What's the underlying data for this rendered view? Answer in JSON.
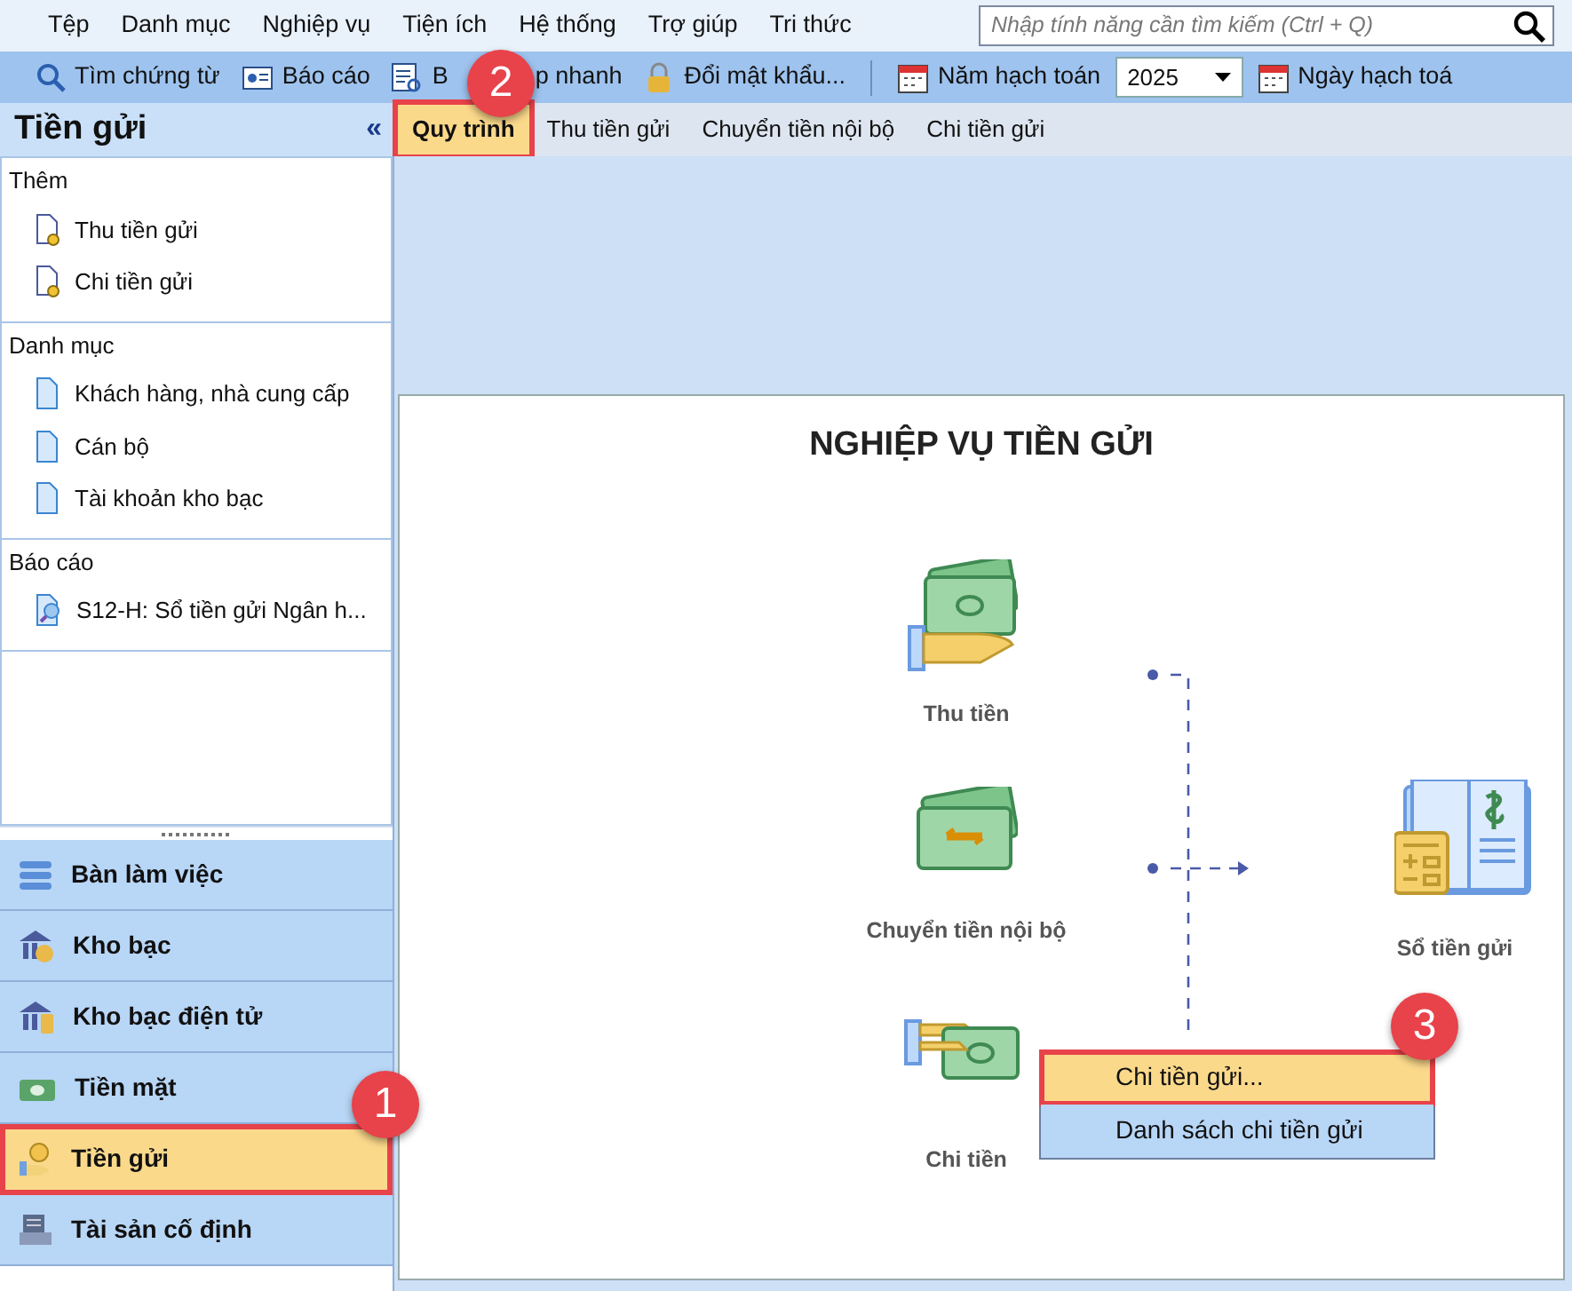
{
  "menu_bar": {
    "items": [
      "Tệp",
      "Danh mục",
      "Nghiệp vụ",
      "Tiện ích",
      "Hệ thống",
      "Trợ giúp",
      "Tri thức"
    ],
    "search": {
      "placeholder": "Nhập tính năng cần tìm kiếm (Ctrl + Q)"
    }
  },
  "toolbar": {
    "items": [
      {
        "kind": "button",
        "label": "Tìm chứng từ"
      },
      {
        "kind": "button",
        "label": "Báo cáo"
      },
      {
        "kind": "split",
        "label_parts": [
          "B",
          "p nhanh"
        ]
      },
      {
        "kind": "button",
        "label": "Đổi mật khẩu..."
      },
      {
        "kind": "separator"
      },
      {
        "kind": "button",
        "label": "Năm hạch toán"
      },
      {
        "kind": "select",
        "value": "2025"
      },
      {
        "kind": "button",
        "label": "Ngày hạch toá"
      }
    ]
  },
  "side_panel": {
    "title": "Tiền gửi",
    "collapse": "«",
    "sections": [
      {
        "title": "Thêm",
        "items": [
          {
            "label": "Thu tiền gửi"
          },
          {
            "label": "Chi tiền gửi"
          }
        ]
      },
      {
        "title": "Danh mục",
        "items": [
          {
            "label": "Khách hàng, nhà cung cấp"
          },
          {
            "label": "Cán bộ"
          },
          {
            "label": "Tài khoản kho bạc"
          }
        ]
      },
      {
        "title": "Báo cáo",
        "items": [
          {
            "label": "S12-H: Sổ tiền gửi Ngân h..."
          }
        ]
      }
    ],
    "modules": [
      {
        "label": "Bàn làm việc",
        "selected": false
      },
      {
        "label": "Kho bạc",
        "selected": false
      },
      {
        "label": "Kho bạc điện tử",
        "selected": false
      },
      {
        "label": "Tiền mặt",
        "selected": false
      },
      {
        "label": "Tiền gửi",
        "selected": true
      },
      {
        "label": "Tài sản cố định",
        "selected": false
      }
    ]
  },
  "tabs": [
    {
      "label": "Quy trình",
      "selected": true
    },
    {
      "label": "Thu tiền gửi",
      "selected": false
    },
    {
      "label": "Chuyển tiền nội bộ",
      "selected": false
    },
    {
      "label": "Chi tiền gửi",
      "selected": false
    }
  ],
  "diagram": {
    "title": "NGHIỆP VỤ TIỀN GỬI",
    "nodes": [
      {
        "label": "Thu tiền",
        "kind": "receive"
      },
      {
        "label": "Chuyển tiền nội bộ",
        "kind": "transfer"
      },
      {
        "label": "Chi tiền",
        "kind": "pay"
      },
      {
        "label": "Sổ tiền gửi",
        "kind": "ledger"
      }
    ]
  },
  "context_menu": {
    "items": [
      {
        "label": "Chi tiền gửi...",
        "selected": true
      },
      {
        "label": "Danh sách chi tiền gửi",
        "selected": false
      }
    ]
  },
  "callouts": [
    "1",
    "2",
    "3"
  ]
}
